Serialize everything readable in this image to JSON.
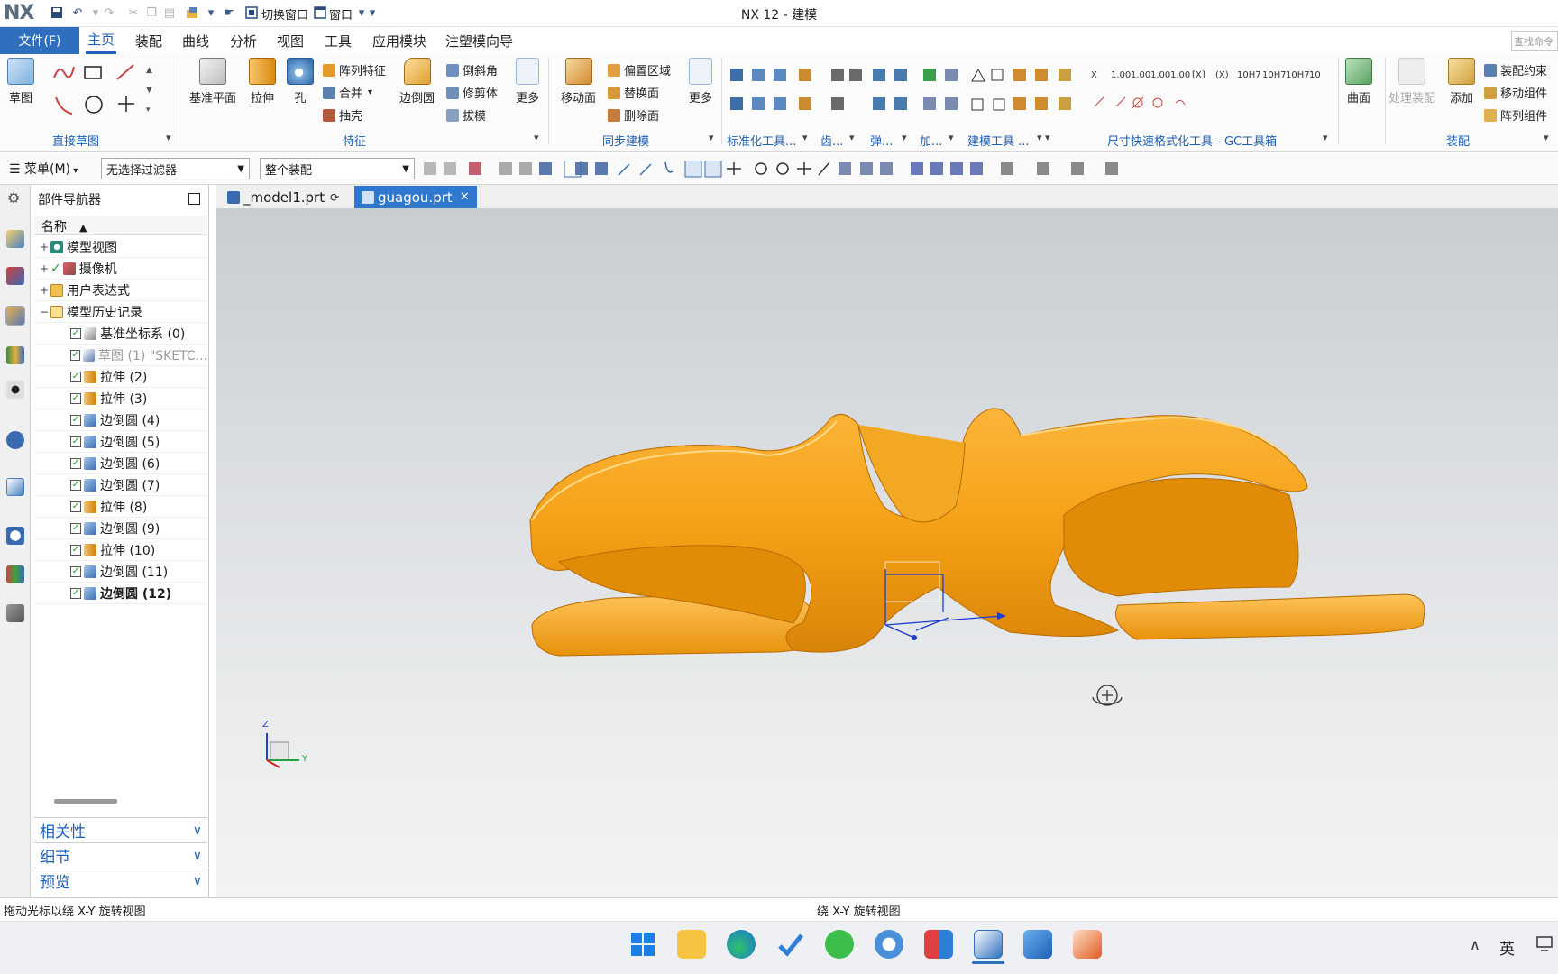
{
  "app": {
    "logo": "NX",
    "title": "NX 12 - 建模",
    "quick_access": {
      "switch_window": "切换窗口",
      "window": "窗口"
    }
  },
  "menu_tabs": [
    "文件(F)",
    "主页",
    "装配",
    "曲线",
    "分析",
    "视图",
    "工具",
    "应用模块",
    "注塑模向导"
  ],
  "active_tab": "主页",
  "find_command_placeholder": "查找命令",
  "ribbon": {
    "sketch": {
      "label": "草图",
      "group": "直接草图"
    },
    "feature": {
      "datum_plane": "基准平面",
      "extrude": "拉伸",
      "hole": "孔",
      "pattern_feature": "阵列特征",
      "unite": "合并",
      "shell": "抽壳",
      "edge_blend": "边倒圆",
      "chamfer": "倒斜角",
      "trim_body": "修剪体",
      "draft": "拔模",
      "more": "更多",
      "group": "特征"
    },
    "sync": {
      "move_face": "移动面",
      "offset_region": "偏置区域",
      "replace_face": "替换面",
      "delete_face": "删除面",
      "more": "更多",
      "group": "同步建模"
    },
    "groups_small": [
      "标准化工具...",
      "齿...",
      "弹...",
      "加...",
      "建模工具 ...",
      "尺寸快速格式化工具 - GC工具箱"
    ],
    "surface": "曲面",
    "assembly": {
      "process_assembly": "处理装配",
      "add": "添加",
      "assembly_constraint": "装配约束",
      "move_component": "移动组件",
      "pattern_component": "阵列组件",
      "group": "装配"
    }
  },
  "toolbar": {
    "menu": "菜单(M)",
    "filter": "无选择过滤器",
    "scope": "整个装配"
  },
  "navigator": {
    "title": "部件导航器",
    "column": "名称",
    "nodes": [
      {
        "label": "模型视图",
        "level": 0,
        "expander": "+"
      },
      {
        "label": "摄像机",
        "level": 0,
        "expander": "+"
      },
      {
        "label": "用户表达式",
        "level": 0,
        "expander": "+"
      },
      {
        "label": "模型历史记录",
        "level": 0,
        "expander": "−"
      }
    ],
    "history": [
      {
        "label": "基准坐标系 (0)",
        "icon": "datum-csys-icon",
        "style": "normal"
      },
      {
        "label": "草图 (1) \"SKETC...",
        "icon": "sketch-icon",
        "style": "gray"
      },
      {
        "label": "拉伸 (2)",
        "icon": "extrude-icon",
        "style": "normal"
      },
      {
        "label": "拉伸 (3)",
        "icon": "extrude-icon",
        "style": "normal"
      },
      {
        "label": "边倒圆 (4)",
        "icon": "edge-blend-icon",
        "style": "normal"
      },
      {
        "label": "边倒圆 (5)",
        "icon": "edge-blend-icon",
        "style": "normal"
      },
      {
        "label": "边倒圆 (6)",
        "icon": "edge-blend-icon",
        "style": "normal"
      },
      {
        "label": "边倒圆 (7)",
        "icon": "edge-blend-icon",
        "style": "normal"
      },
      {
        "label": "拉伸 (8)",
        "icon": "extrude-icon",
        "style": "normal"
      },
      {
        "label": "边倒圆 (9)",
        "icon": "edge-blend-icon",
        "style": "normal"
      },
      {
        "label": "拉伸 (10)",
        "icon": "extrude-icon",
        "style": "normal"
      },
      {
        "label": "边倒圆 (11)",
        "icon": "edge-blend-icon",
        "style": "normal"
      },
      {
        "label": "边倒圆 (12)",
        "icon": "edge-blend-icon",
        "style": "bold"
      }
    ],
    "panels": [
      "相关性",
      "细节",
      "预览"
    ]
  },
  "doc_tabs": [
    {
      "label": "_model1.prt",
      "active": false
    },
    {
      "label": "guagou.prt",
      "active": true
    }
  ],
  "triad": {
    "z": "Z",
    "y": "Y",
    "x": "X"
  },
  "status": {
    "left": "拖动光标以绕 X-Y 旋转视图",
    "center": "绕 X-Y 旋转视图"
  },
  "taskbar": {
    "ime": "英"
  },
  "colors": {
    "accent": "#1c5fb5",
    "file_tab": "#2f6fbe",
    "model": "#f5a015",
    "model_shadow": "#d88408"
  }
}
